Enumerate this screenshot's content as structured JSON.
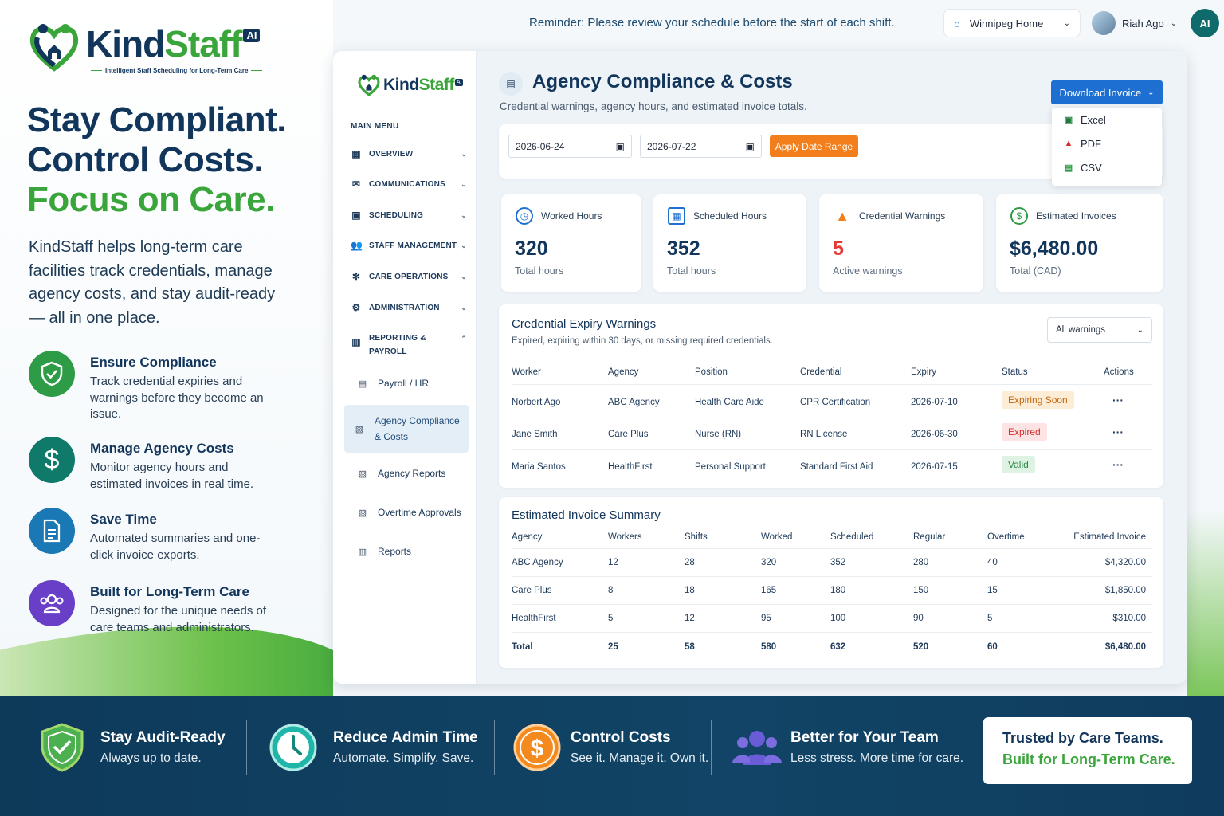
{
  "brand": {
    "name_a": "Kind",
    "name_b": "Staff",
    "badge": "AI",
    "tagline": "Intelligent Staff Scheduling for Long-Term Care"
  },
  "marketing": {
    "headline_1": "Stay Compliant.",
    "headline_2": "Control Costs.",
    "headline_3": "Focus on Care.",
    "lead": "KindStaff helps long-term care facilities track credentials, manage agency costs, and stay audit-ready — all in one place.",
    "features": [
      {
        "title": "Ensure Compliance",
        "text": "Track credential expiries and warnings before they become an issue.",
        "icon": "shield-check-icon",
        "color": "#2e9b47"
      },
      {
        "title": "Manage Agency Costs",
        "text": "Monitor agency hours and estimated invoices in real time.",
        "icon": "dollar-icon",
        "color": "#0f7a6a"
      },
      {
        "title": "Save Time",
        "text": "Automated summaries and one-click invoice exports.",
        "icon": "document-icon",
        "color": "#1a78b5"
      },
      {
        "title": "Built for Long-Term Care",
        "text": "Designed for the unique needs of care teams and administrators.",
        "icon": "team-icon",
        "color": "#6a3fc8"
      }
    ]
  },
  "topbar": {
    "reminder": "Reminder: Please review your schedule before the start of each shift.",
    "location": "Winnipeg Home",
    "user": "Riah Ago",
    "initials": "AI"
  },
  "sidebar": {
    "menu_title": "MAIN MENU",
    "items": [
      "OVERVIEW",
      "COMMUNICATIONS",
      "SCHEDULING",
      "STAFF MANAGEMENT",
      "CARE OPERATIONS",
      "ADMINISTRATION"
    ],
    "reporting": "REPORTING & PAYROLL",
    "subs": [
      "Payroll / HR",
      "Agency Compliance & Costs",
      "Agency Reports",
      "Overtime Approvals",
      "Reports"
    ]
  },
  "page": {
    "title": "Agency Compliance & Costs",
    "subtitle": "Credential warnings, agency hours, and estimated invoice totals.",
    "download": "Download Invoice",
    "download_options": [
      "Excel",
      "PDF",
      "CSV"
    ],
    "date_from": "2026-06-24",
    "date_to": "2026-07-22",
    "apply": "Apply Date Range"
  },
  "kpis": [
    {
      "label": "Worked Hours",
      "value": "320",
      "caption": "Total hours",
      "color": "#1d6fd1"
    },
    {
      "label": "Scheduled Hours",
      "value": "352",
      "caption": "Total hours",
      "color": "#1d6fd1"
    },
    {
      "label": "Credential Warnings",
      "value": "5",
      "caption": "Active warnings",
      "color": "#e53935"
    },
    {
      "label": "Estimated Invoices",
      "value": "$6,480.00",
      "caption": "Total (CAD)",
      "color": "#2e9b47"
    }
  ],
  "warnings": {
    "title": "Credential Expiry Warnings",
    "subtitle": "Expired, expiring within 30 days, or missing required credentials.",
    "filter": "All warnings",
    "columns": [
      "Worker",
      "Agency",
      "Position",
      "Credential",
      "Expiry",
      "Status",
      "Actions"
    ],
    "rows": [
      [
        "Norbert Ago",
        "ABC Agency",
        "Health Care Aide",
        "CPR Certification",
        "2026-07-10",
        "Expiring Soon"
      ],
      [
        "Jane Smith",
        "Care Plus",
        "Nurse (RN)",
        "RN License",
        "2026-06-30",
        "Expired"
      ],
      [
        "Maria Santos",
        "HealthFirst",
        "Personal Support",
        "Standard First Aid",
        "2026-07-15",
        "Valid"
      ]
    ]
  },
  "invoice": {
    "title": "Estimated Invoice Summary",
    "columns": [
      "Agency",
      "Workers",
      "Shifts",
      "Worked",
      "Scheduled",
      "Regular",
      "Overtime",
      "Estimated Invoice"
    ],
    "rows": [
      [
        "ABC Agency",
        "12",
        "28",
        "320",
        "352",
        "280",
        "40",
        "$4,320.00"
      ],
      [
        "Care Plus",
        "8",
        "18",
        "165",
        "180",
        "150",
        "15",
        "$1,850.00"
      ],
      [
        "HealthFirst",
        "5",
        "12",
        "95",
        "100",
        "90",
        "5",
        "$310.00"
      ],
      [
        "Total",
        "25",
        "58",
        "580",
        "632",
        "520",
        "60",
        "$6,480.00"
      ]
    ]
  },
  "band": [
    {
      "t1": "Stay Audit-Ready",
      "t2": "Always up to date.",
      "icon": "shield-icon"
    },
    {
      "t1": "Reduce Admin Time",
      "t2": "Automate. Simplify. Save.",
      "icon": "clock-icon"
    },
    {
      "t1": "Control Costs",
      "t2": "See it. Manage it. Own it.",
      "icon": "dollar-coin-icon"
    },
    {
      "t1": "Better for Your Team",
      "t2": "Less stress. More time for care.",
      "icon": "people-icon"
    }
  ],
  "trust": {
    "a": "Trusted by Care Teams.",
    "b": "Built for Long-Term Care."
  }
}
